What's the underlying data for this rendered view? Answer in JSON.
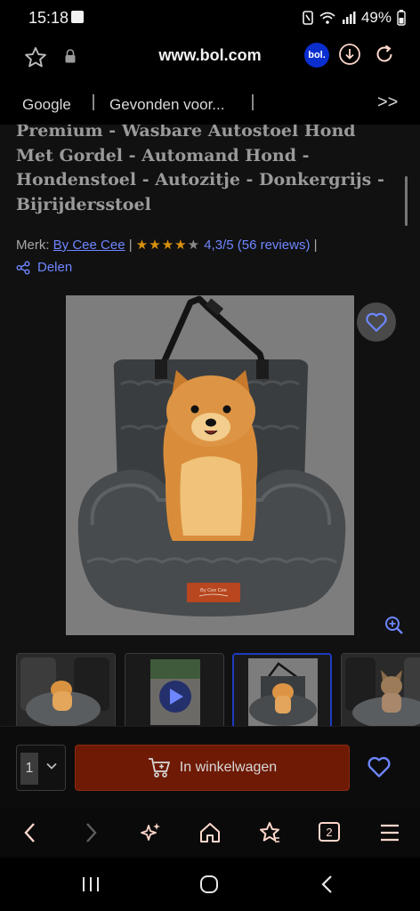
{
  "status_bar": {
    "time": "15:18",
    "battery": "49%"
  },
  "browser": {
    "url": "www.bol.com",
    "site_badge": "bol.",
    "bookmarks": [
      "Google",
      "Gevonden voor...",
      ">>"
    ]
  },
  "product": {
    "title": "Premium - Wasbare Autostoel Hond Met Gordel - Automand Hond - Hondenstoel - Autozitje - Donkergrijs - Bijrijdersstoel",
    "brand_label": "Merk:",
    "brand": "By Cee Cee",
    "separator": "|",
    "stars": "★★★★",
    "star_dim": "★",
    "rating": "4,3/5 (56 reviews)",
    "share_label": "Delen",
    "rating_value": 4.3,
    "review_count": 56,
    "image_label_text": "By Cee Cee"
  },
  "thumbnails": [
    {
      "name": "thumb-car-seat-pomeranian"
    },
    {
      "name": "thumb-video"
    },
    {
      "name": "thumb-product-selected"
    },
    {
      "name": "thumb-french-bulldog"
    }
  ],
  "cart": {
    "quantity": "1",
    "button_label": "In winkelwagen"
  },
  "nav": {
    "tab_count": "2"
  },
  "colors": {
    "accent_blue": "#6e86ff",
    "cart_button": "#6e1a04",
    "star": "#d8910f",
    "bol_blue": "#0b2ecf"
  }
}
